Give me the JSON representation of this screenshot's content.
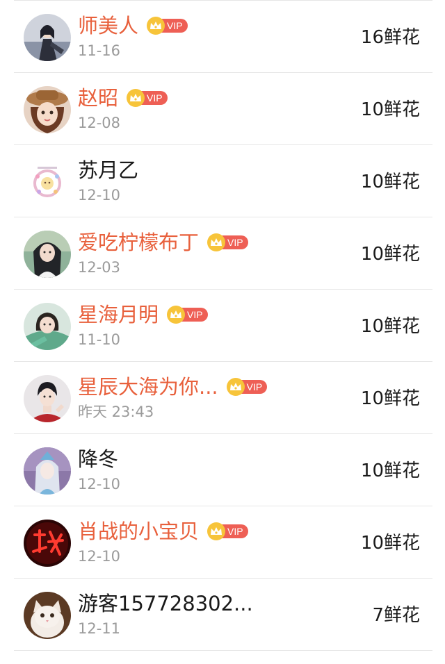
{
  "colors": {
    "vip_name": "#e8603c",
    "normal_name": "#1a1a1a",
    "date": "#9b9b9b",
    "vip_badge": "#ee5f55",
    "crown": "#f7c43a"
  },
  "entries": [
    {
      "name": "师美人",
      "vip": true,
      "vip_label": "VIP",
      "date": "11-16",
      "flowers": "16鲜花",
      "avatar_icon": "girl-dark-dress-avatar"
    },
    {
      "name": "赵昭",
      "vip": true,
      "vip_label": "VIP",
      "date": "12-08",
      "flowers": "10鲜花",
      "avatar_icon": "girl-hat-avatar"
    },
    {
      "name": "苏月乙",
      "vip": false,
      "vip_label": "",
      "date": "12-10",
      "flowers": "10鲜花",
      "avatar_icon": "flower-wreath-avatar"
    },
    {
      "name": "爱吃柠檬布丁",
      "vip": true,
      "vip_label": "VIP",
      "date": "12-03",
      "flowers": "10鲜花",
      "avatar_icon": "girl-long-hair-avatar"
    },
    {
      "name": "星海月明",
      "vip": true,
      "vip_label": "VIP",
      "date": "11-10",
      "flowers": "10鲜花",
      "avatar_icon": "girl-green-avatar"
    },
    {
      "name": "星辰大海为你...",
      "vip": true,
      "vip_label": "VIP",
      "date": "昨天 23:43",
      "flowers": "10鲜花",
      "avatar_icon": "boy-red-jacket-avatar"
    },
    {
      "name": "降冬",
      "vip": false,
      "vip_label": "",
      "date": "12-10",
      "flowers": "10鲜花",
      "avatar_icon": "anime-purple-avatar"
    },
    {
      "name": "肖战的小宝贝",
      "vip": true,
      "vip_label": "VIP",
      "date": "12-10",
      "flowers": "10鲜花",
      "avatar_icon": "red-neon-avatar"
    },
    {
      "name": "游客157728302...",
      "vip": false,
      "vip_label": "",
      "date": "12-11",
      "flowers": "7鲜花",
      "avatar_icon": "kitten-avatar"
    }
  ]
}
